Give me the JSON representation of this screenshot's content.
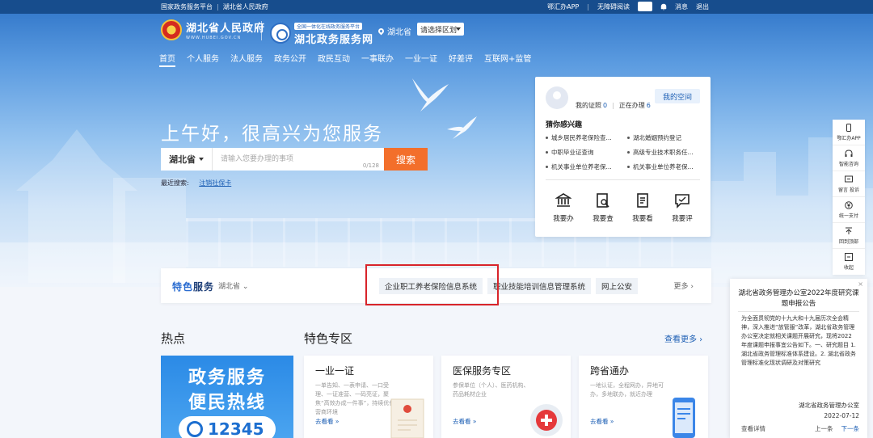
{
  "topbar": {
    "left_links": [
      "国家政务服务平台",
      "湖北省人民政府"
    ],
    "right_links": [
      "鄂汇办APP",
      "无障碍阅读"
    ],
    "messages": "消息",
    "logout": "退出"
  },
  "header": {
    "gov_name": "湖北省人民政府",
    "gov_url": "WWW.HUBEI.GOV.CN",
    "platform_tag": "全国一体化在线政务服务平台",
    "platform_name": "湖北政务服务网",
    "province": "湖北省",
    "region_select": "请选择区划"
  },
  "nav": {
    "items": [
      "首页",
      "个人服务",
      "法人服务",
      "政务公开",
      "政民互动",
      "一事联办",
      "一业一证",
      "好差评",
      "互联网+监管"
    ]
  },
  "hero": {
    "greeting": "上午好，很高兴为您服务"
  },
  "search": {
    "scope": "湖北省",
    "placeholder": "请输入您要办理的事项",
    "counter": "0/128",
    "button": "搜索",
    "recent_label": "最近搜索:",
    "recent_item": "注销社保卡"
  },
  "user_card": {
    "certs_label": "我的证照",
    "certs_count": "0",
    "processing_label": "正在办理",
    "processing_count": "6",
    "space_button": "我的空间",
    "interest_title": "猜你感兴趣",
    "interests": [
      "城乡居民养老保险查...",
      "湖北婚姻预约登记",
      "中职毕业证查询",
      "高级专业技术职务任...",
      "机关事业单位养老保...",
      "机关事业单位养老保..."
    ],
    "actions": [
      {
        "label": "我要办",
        "icon": "bank-icon"
      },
      {
        "label": "我要查",
        "icon": "search-doc-icon"
      },
      {
        "label": "我要看",
        "icon": "document-icon"
      },
      {
        "label": "我要评",
        "icon": "comment-icon"
      }
    ]
  },
  "float_toolbar": [
    {
      "label": "鄂汇办APP",
      "icon": "phone-icon"
    },
    {
      "label": "智能咨询",
      "icon": "headset-icon"
    },
    {
      "label": "留言 投诉",
      "icon": "message-icon"
    },
    {
      "label": "统一支付",
      "icon": "yuan-icon"
    },
    {
      "label": "回到顶部",
      "icon": "arrow-up-icon"
    },
    {
      "label": "收起",
      "icon": "collapse-icon"
    }
  ],
  "features": {
    "title_a": "特色",
    "title_b": "服务",
    "region": "湖北省",
    "chips": [
      "企业职工养老保险信息系统",
      "职业技能培训信息管理系统",
      "网上公安"
    ],
    "more": "更多"
  },
  "hot": {
    "title": "热点",
    "line1": "政务服务",
    "line2": "便民热线",
    "number": "12345"
  },
  "zone": {
    "title": "特色专区",
    "more": "查看更多",
    "cards": [
      {
        "title": "一业一证",
        "desc": "一单告知、一表申请、一口受理、一证准营、一码亮证，聚焦“高效办成一件事”，持续优化营商环境",
        "more": "去看看"
      },
      {
        "title": "医保服务专区",
        "desc": "参保单位（个人）、医药机构、药品耗材企业",
        "more": "去看看"
      },
      {
        "title": "跨省通办",
        "desc": "一地认证，全程网办，异地可办，多地联办，就近办理",
        "more": "去看看"
      }
    ]
  },
  "notice": {
    "close": "×",
    "title": "湖北省政务管理办公室2022年度研究课题申报公告",
    "body": "为全面贯彻党的十九大和十九届历次全会精神，深入推进“放管服”改革，湖北省政务管理办公室决定就相关课题开展研究，现将2022年度课题申报事宜公告如下。一、研究题目 1. 湖北省政务管理标准体系建设。2. 湖北省政务管理标准化现状调研及对策研究",
    "signer": "湖北省政务管理办公室",
    "date": "2022-07-12",
    "detail": "查看详情",
    "prev": "上一条",
    "next": "下一条"
  },
  "colors": {
    "brand_blue": "#1d5fb4",
    "search_orange": "#f36f2b",
    "highlight_red": "#d8242a",
    "topbar": "#174d8d"
  }
}
